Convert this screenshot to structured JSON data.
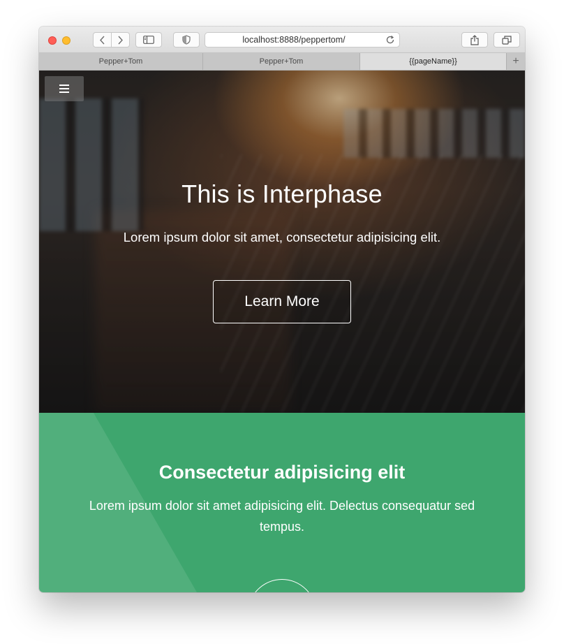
{
  "browser": {
    "url": "localhost:8888/peppertom/",
    "tabs": [
      {
        "label": "Pepper+Tom",
        "active": false
      },
      {
        "label": "Pepper+Tom",
        "active": false
      },
      {
        "label": "{{pageName}}",
        "active": true
      }
    ],
    "new_tab_icon": "plus-icon"
  },
  "hero": {
    "title": "This is Interphase",
    "subtitle": "Lorem ipsum dolor sit amet, consectetur adipisicing elit.",
    "cta_label": "Learn More",
    "menu_icon": "hamburger-icon"
  },
  "feature": {
    "title": "Consectetur adipisicing elit",
    "body": "Lorem ipsum dolor sit amet adipisicing elit. Delectus consequatur sed tempus."
  },
  "colors": {
    "accent_green": "#3ea66e",
    "close": "#ff5f57",
    "minimize": "#ffbd2e",
    "maximize": "#28c940"
  }
}
